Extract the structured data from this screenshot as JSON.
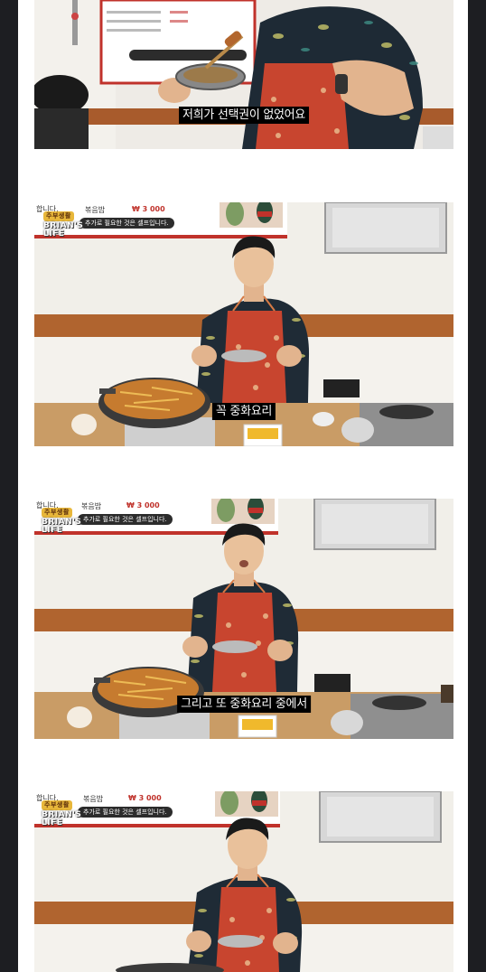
{
  "frames": [
    {
      "subtitle": "저희가 선택권이 없었어요"
    },
    {
      "subtitle": "꼭 중화요리",
      "sign": {
        "menu_item": "볶음밥",
        "price": "₩ 3 000",
        "notice": "추가로 필요한 것은 셀프입니다.",
        "header_fragment": "합니다."
      },
      "logo": {
        "tag": "주부생활",
        "line1": "BRIAN'S",
        "line2": "LIFE"
      }
    },
    {
      "subtitle": "그리고 또 중화요리 중에서",
      "sign": {
        "menu_item": "볶음밥",
        "price": "₩ 3 000",
        "notice": "추가로 필요한 것은 셀프입니다.",
        "header_fragment": "합니다."
      },
      "logo": {
        "tag": "주부생활",
        "line1": "BRIAN'S",
        "line2": "LIFE"
      }
    },
    {
      "subtitle": "",
      "sign": {
        "menu_item": "볶음밥",
        "price": "₩ 3 000",
        "notice": "추가로 필요한 것은 셀프입니다.",
        "header_fragment": "합니다."
      },
      "logo": {
        "tag": "주부생활",
        "line1": "BRIAN'S",
        "line2": "LIFE"
      }
    }
  ],
  "colors": {
    "background": "#1d1e22",
    "page": "#ffffff",
    "wall": "#f1efe9",
    "wall_stripe": "#b0642f",
    "apron": "#c8452f",
    "shirt": "#1f2b36",
    "subtitle_bg": "#000000",
    "subtitle_text": "#ffffff"
  }
}
